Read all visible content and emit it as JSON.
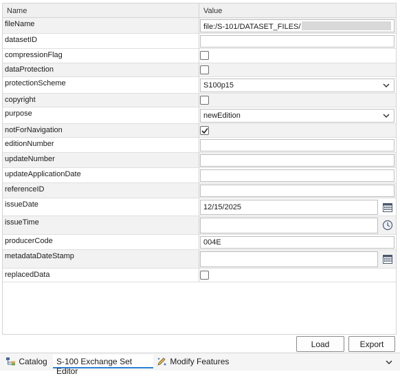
{
  "grid": {
    "header": {
      "name": "Name",
      "value": "Value"
    },
    "rows": [
      {
        "name": "fileName",
        "value": "file:/S-101/DATASET_FILES/"
      },
      {
        "name": "datasetID",
        "value": ""
      },
      {
        "name": "compressionFlag",
        "checked": false
      },
      {
        "name": "dataProtection",
        "checked": false
      },
      {
        "name": "protectionScheme",
        "value": "S100p15"
      },
      {
        "name": "copyright",
        "checked": false
      },
      {
        "name": "purpose",
        "value": "newEdition"
      },
      {
        "name": "notForNavigation",
        "checked": true
      },
      {
        "name": "editionNumber",
        "value": ""
      },
      {
        "name": "updateNumber",
        "value": ""
      },
      {
        "name": "updateApplicationDate",
        "value": ""
      },
      {
        "name": "referenceID",
        "value": ""
      },
      {
        "name": "issueDate",
        "value": "12/15/2025"
      },
      {
        "name": "issueTime",
        "value": ""
      },
      {
        "name": "producerCode",
        "value": "004E"
      },
      {
        "name": "metadataDateStamp",
        "value": ""
      },
      {
        "name": "replacedData",
        "checked": false
      }
    ]
  },
  "actions": {
    "load": "Load",
    "export": "Export"
  },
  "tabs": {
    "catalog": "Catalog",
    "exchange_set_editor": "S-100 Exchange Set Editor",
    "modify_features": "Modify Features"
  },
  "colors": {
    "accent": "#2a7fd4",
    "row_alt": "#f2f2f2"
  }
}
